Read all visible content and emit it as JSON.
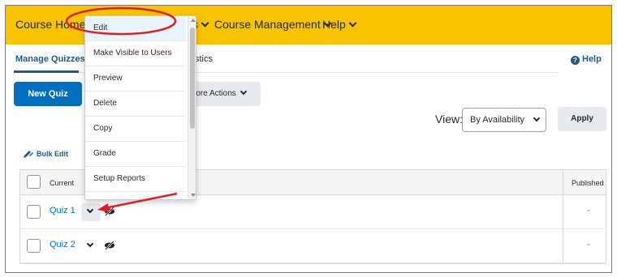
{
  "nav": {
    "course_home": "Course Home",
    "partial_item": "s",
    "course_management": "Course Management",
    "help": "Help"
  },
  "tabs": {
    "manage_quizzes": "Manage Quizzes",
    "statistics_partial": "stics"
  },
  "help_link": "Help",
  "buttons": {
    "new_quiz": "New Quiz",
    "more_actions": "More Actions",
    "apply": "Apply"
  },
  "view": {
    "label": "View:",
    "selected": "By Availability"
  },
  "bulk_edit": "Bulk Edit",
  "table": {
    "header_current_partial": "Current",
    "header_published": "Published",
    "rows": [
      {
        "name": "Quiz 1",
        "published": "-"
      },
      {
        "name": "Quiz 2",
        "published": "-"
      }
    ]
  },
  "context_menu": {
    "items": [
      "Edit",
      "Make Visible to Users",
      "Preview",
      "Delete",
      "Copy",
      "Grade",
      "Setup Reports"
    ],
    "selected_index": 0
  },
  "colors": {
    "nav_bar": "#f8c400",
    "primary_button": "#006fbf",
    "link": "#006fbf",
    "annotation": "#e31b23"
  },
  "icons": {
    "help": "help-circle-icon",
    "bulk_edit": "pencil-icon",
    "chevron": "chevron-down-icon",
    "visibility": "eye-slash-icon"
  }
}
